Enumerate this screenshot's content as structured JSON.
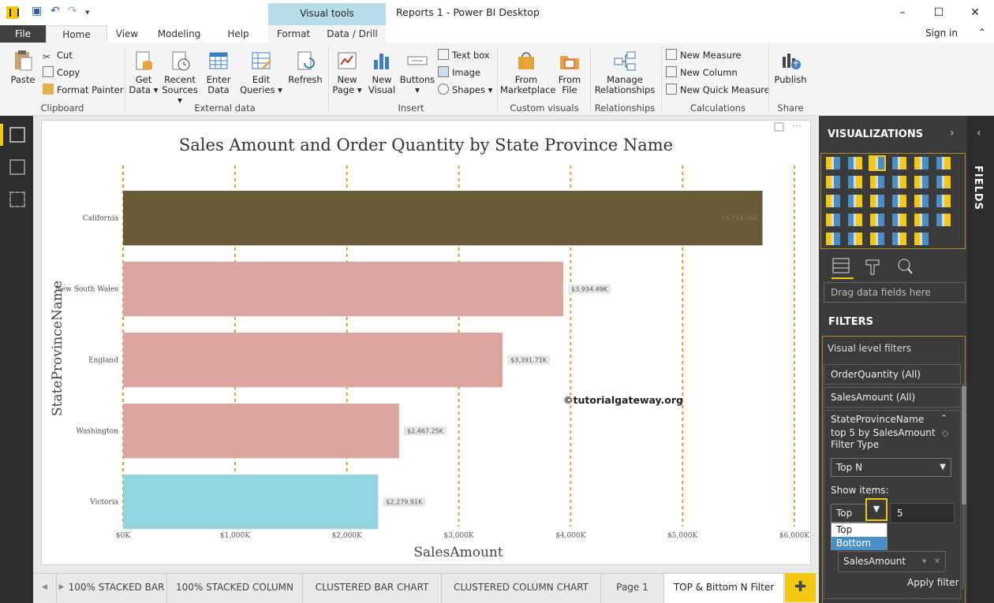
{
  "titlebar": {
    "visual_tools": "Visual tools",
    "window_title": "Reports 1 - Power BI Desktop",
    "minimize": "–",
    "maximize": "☐",
    "close": "✕"
  },
  "tabs": {
    "file": "File",
    "home": "Home",
    "view": "View",
    "modeling": "Modeling",
    "help": "Help",
    "format": "Format",
    "data_drill": "Data / Drill",
    "signin": "Sign in"
  },
  "ribbon": {
    "paste": "Paste",
    "cut": "Cut",
    "copy": "Copy",
    "format_painter": "Format Painter",
    "clipboard": "Clipboard",
    "get_data": [
      "Get",
      "Data ▾"
    ],
    "recent_sources": [
      "Recent",
      "Sources ▾"
    ],
    "enter_data": [
      "Enter",
      "Data"
    ],
    "edit_queries": [
      "Edit",
      "Queries ▾"
    ],
    "refresh": "Refresh",
    "external_data": "External data",
    "new_page": [
      "New",
      "Page ▾"
    ],
    "new_visual": [
      "New",
      "Visual"
    ],
    "buttons": [
      "Buttons",
      "▾"
    ],
    "text_box": "Text box",
    "image": "Image",
    "shapes": "Shapes ▾",
    "insert": "Insert",
    "from_marketplace": [
      "From",
      "Marketplace"
    ],
    "from_file": [
      "From",
      "File"
    ],
    "custom_visuals": "Custom visuals",
    "manage_relationships": [
      "Manage",
      "Relationships"
    ],
    "relationships": "Relationships",
    "new_measure": "New Measure",
    "new_column": "New Column",
    "new_quick_measure": "New Quick Measure",
    "calculations": "Calculations",
    "publish": "Publish",
    "share": "Share"
  },
  "chart_data": {
    "type": "bar",
    "title": "Sales Amount and Order Quantity by State Province Name",
    "xlabel": "SalesAmount",
    "ylabel": "StateProvinceName",
    "categories": [
      "California",
      "New South Wales",
      "England",
      "Washington",
      "Victoria"
    ],
    "values": [
      5714.36,
      3934.49,
      3391.71,
      2467.25,
      2279.91
    ],
    "data_labels": [
      "$5,714.36K",
      "$3,934.49K",
      "$3,391.71K",
      "$2,467.25K",
      "$2,279.91K"
    ],
    "xlim": [
      0,
      6000
    ],
    "xticks": [
      "$0K",
      "$1,000K",
      "$2,000K",
      "$3,000K",
      "$4,000K",
      "$5,000K",
      "$6,000K"
    ],
    "grid": true,
    "watermark": "©tutorialgateway.org",
    "colors": [
      "#6b5a3a",
      "#dba6a2",
      "#dca5a0",
      "#dca5a0",
      "#92d5e1"
    ]
  },
  "pages": {
    "tabs": [
      "100% STACKED BAR",
      "100% STACKED COLUMN",
      "CLUSTERED BAR CHART",
      "CLUSTERED COLUMN CHART",
      "Page 1",
      "TOP & Bittom N Filter"
    ],
    "add": "✚",
    "prev": "◀",
    "next": "▶"
  },
  "pane": {
    "visualizations": "VISUALIZATIONS",
    "fields": "FIELDS",
    "drag_fields": "Drag data fields here",
    "filters": "FILTERS",
    "visual_level_filters": "Visual level filters",
    "order_quantity": "OrderQuantity (All)",
    "sales_amount": "SalesAmount (All)",
    "state_field": "StateProvinceName",
    "state_summary": "top 5 by SalesAmount",
    "filter_type_label": "Filter Type",
    "filter_type_value": "Top N",
    "show_items_label": "Show items:",
    "show_items_value": "Top",
    "show_items_count": "5",
    "dropdown_options": [
      "Top",
      "Bottom"
    ],
    "by_value_field": "SalesAmount",
    "apply_filter": "Apply filter"
  }
}
